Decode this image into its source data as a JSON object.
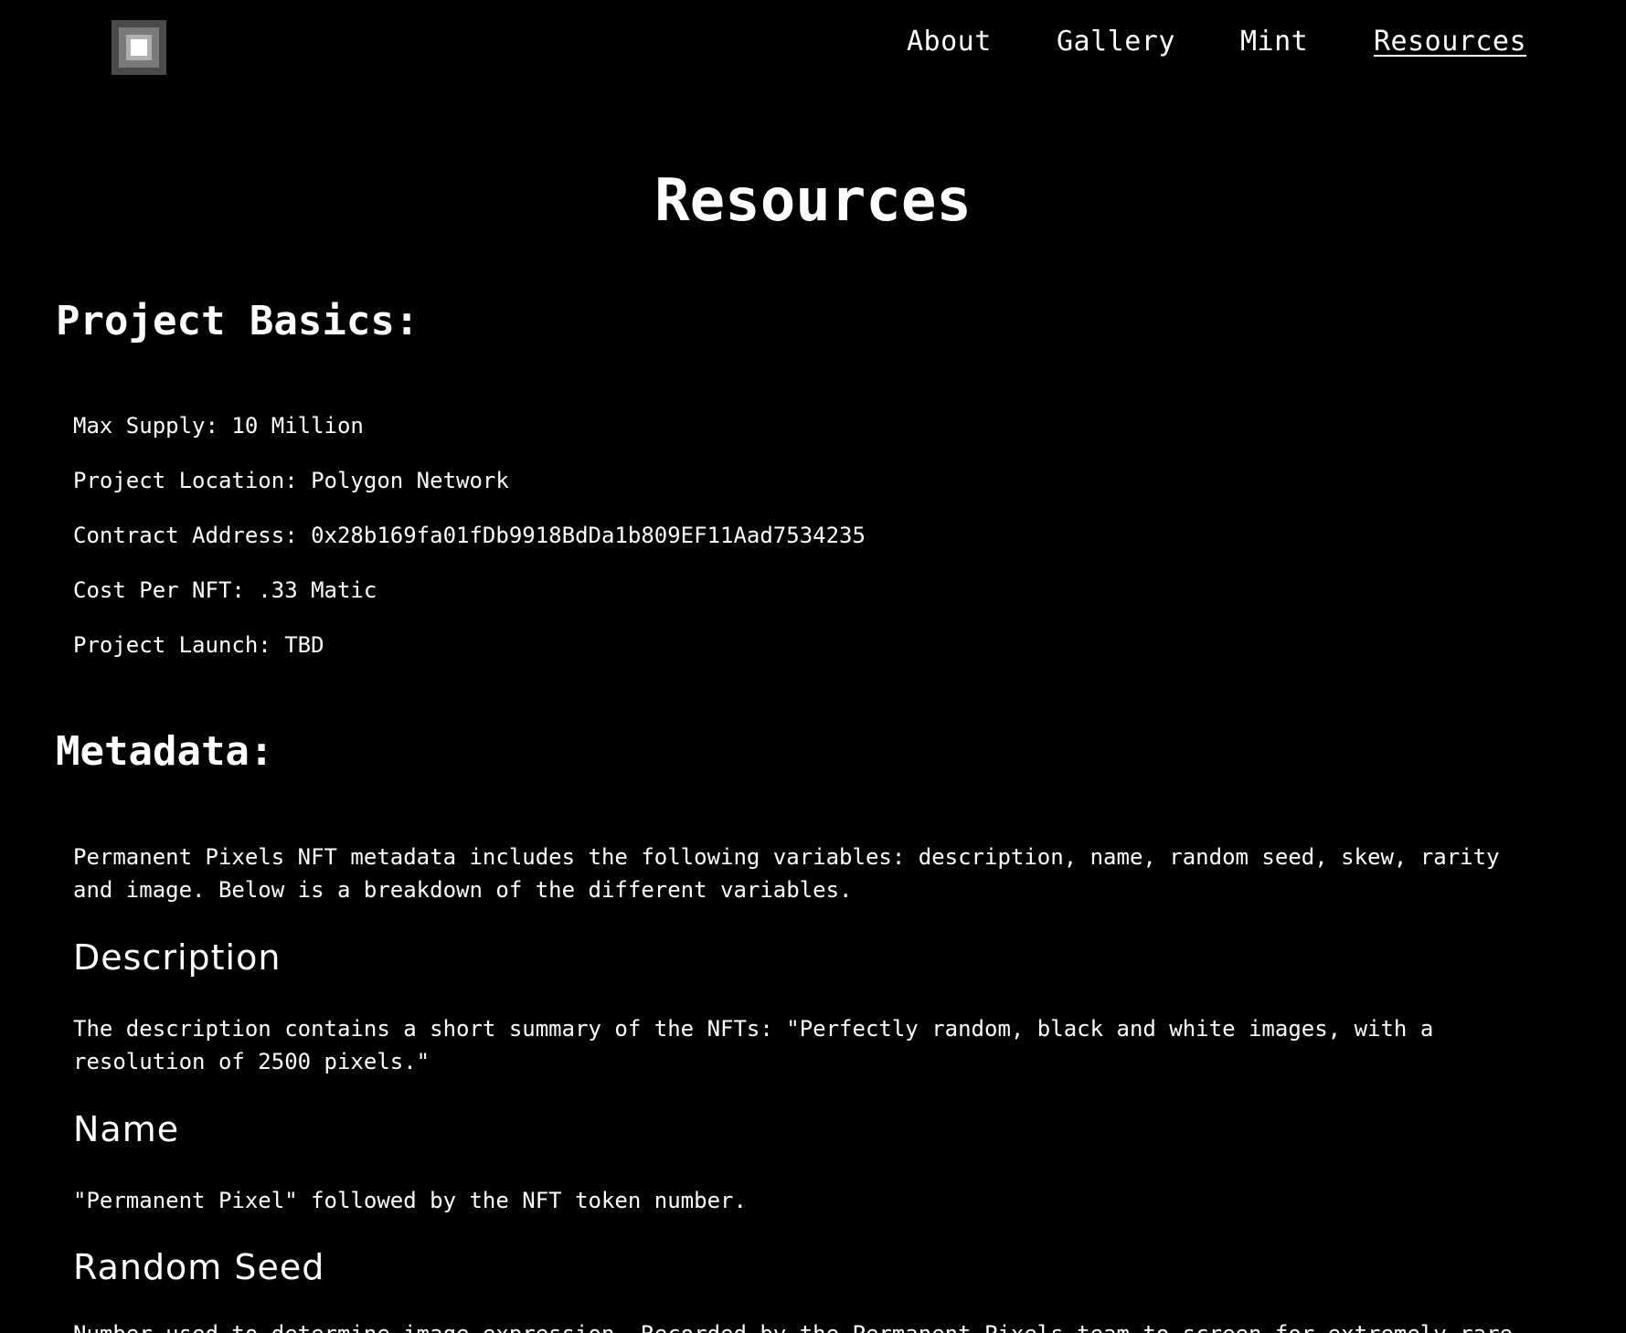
{
  "nav": {
    "logo_alt": "Permanent Pixels",
    "links": [
      {
        "label": "About"
      },
      {
        "label": "Gallery"
      },
      {
        "label": "Mint"
      },
      {
        "label": "Resources",
        "active": true
      }
    ]
  },
  "page": {
    "title": "Resources"
  },
  "project_basics": {
    "heading": "Project Basics:",
    "items": [
      {
        "text": "Max Supply: 10 Million"
      },
      {
        "text": "Project Location: Polygon Network"
      },
      {
        "text": "Contract Address: 0x28b169fa01fDb9918BdDa1b809EF11Aad7534235"
      },
      {
        "text": "Cost Per NFT: .33 Matic"
      },
      {
        "text": "Project Launch: TBD"
      }
    ]
  },
  "metadata": {
    "heading": "Metadata:",
    "intro": "Permanent Pixels NFT metadata includes the following variables: description, name, random seed, skew, rarity and image. Below is a breakdown of the different variables.",
    "sections": [
      {
        "title": "Description",
        "body": "The description contains a short summary of the NFTs: \"Perfectly random, black and white images, with a resolution of 2500 pixels.\""
      },
      {
        "title": "Name",
        "body": "\"Permanent Pixel\" followed by the NFT token number."
      },
      {
        "title": "Random Seed",
        "body": "Number used to determine image expression. Recorded by the Permanent Pixels team to screen for extremely rare"
      }
    ]
  },
  "colors": {
    "background": "#000000",
    "text": "#ffffff"
  }
}
